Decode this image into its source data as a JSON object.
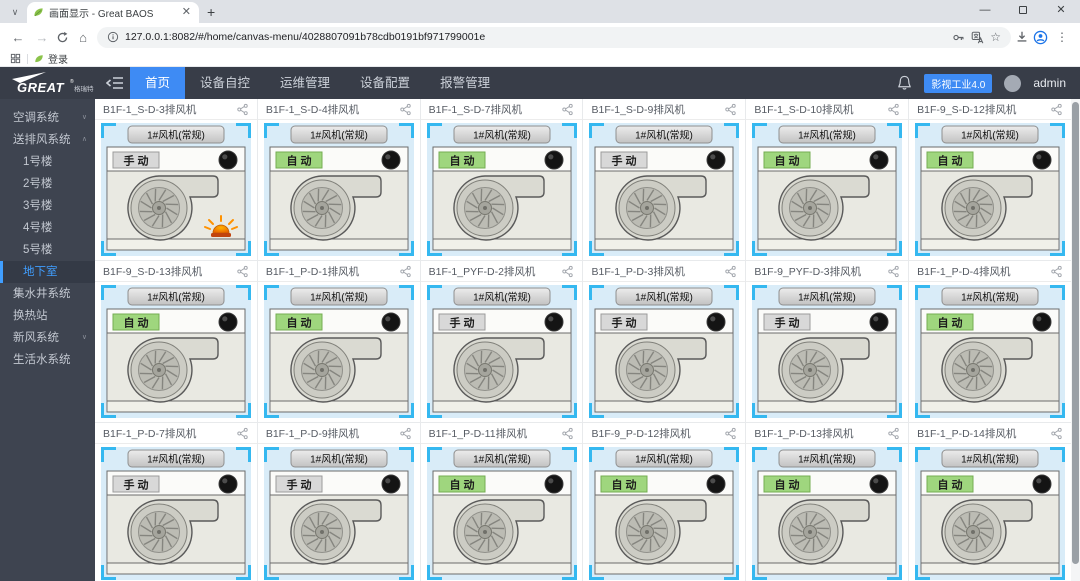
{
  "browser": {
    "tab_title": "画面显示 - Great BAOS",
    "new_tab_button": "+",
    "url": "127.0.0.1:8082/#/home/canvas-menu/4028807091b78cdb0191bf971799001e",
    "bookmarks": [
      {
        "label": "登录"
      }
    ]
  },
  "header": {
    "logo_text": "GREAT",
    "logo_registered": "®",
    "logo_sub": "格瑞特",
    "nav": [
      {
        "label": "首页",
        "active": true
      },
      {
        "label": "设备自控",
        "active": false
      },
      {
        "label": "运维管理",
        "active": false
      },
      {
        "label": "设备配置",
        "active": false
      },
      {
        "label": "报警管理",
        "active": false
      }
    ],
    "badge_label": "影视工业4.0",
    "username": "admin"
  },
  "sidebar": {
    "items": [
      {
        "label": "空调系统",
        "type": "group",
        "chevron": "down",
        "active": false
      },
      {
        "label": "送排风系统",
        "type": "group",
        "chevron": "up",
        "active": false
      },
      {
        "label": "1号楼",
        "type": "child",
        "chevron": "",
        "active": false
      },
      {
        "label": "2号楼",
        "type": "child",
        "chevron": "",
        "active": false
      },
      {
        "label": "3号楼",
        "type": "child",
        "chevron": "",
        "active": false
      },
      {
        "label": "4号楼",
        "type": "child",
        "chevron": "",
        "active": false
      },
      {
        "label": "5号楼",
        "type": "child",
        "chevron": "",
        "active": false
      },
      {
        "label": "地下室",
        "type": "child",
        "chevron": "",
        "active": true
      },
      {
        "label": "集水井系统",
        "type": "group",
        "chevron": "",
        "active": false
      },
      {
        "label": "换热站",
        "type": "group",
        "chevron": "",
        "active": false
      },
      {
        "label": "新风系统",
        "type": "group",
        "chevron": "down",
        "active": false
      },
      {
        "label": "生活水系统",
        "type": "group",
        "chevron": "",
        "active": false
      }
    ]
  },
  "main": {
    "cards": [
      {
        "title": "B1F-1_S-D-3排风机",
        "fan_label": "1#风机(常规)",
        "mode": "manual",
        "mode_label": "手 动",
        "alarm": true
      },
      {
        "title": "B1F-1_S-D-4排风机",
        "fan_label": "1#风机(常规)",
        "mode": "auto",
        "mode_label": "自 动",
        "alarm": false
      },
      {
        "title": "B1F-1_S-D-7排风机",
        "fan_label": "1#风机(常规)",
        "mode": "auto",
        "mode_label": "自 动",
        "alarm": false
      },
      {
        "title": "B1F-1_S-D-9排风机",
        "fan_label": "1#风机(常规)",
        "mode": "manual",
        "mode_label": "手 动",
        "alarm": false
      },
      {
        "title": "B1F-1_S-D-10排风机",
        "fan_label": "1#风机(常规)",
        "mode": "auto",
        "mode_label": "自 动",
        "alarm": false
      },
      {
        "title": "B1F-9_S-D-12排风机",
        "fan_label": "1#风机(常规)",
        "mode": "auto",
        "mode_label": "自 动",
        "alarm": false
      },
      {
        "title": "B1F-9_S-D-13排风机",
        "fan_label": "1#风机(常规)",
        "mode": "auto",
        "mode_label": "自 动",
        "alarm": false
      },
      {
        "title": "B1F-1_P-D-1排风机",
        "fan_label": "1#风机(常规)",
        "mode": "auto",
        "mode_label": "自 动",
        "alarm": false
      },
      {
        "title": "B1F-1_PYF-D-2排风机",
        "fan_label": "1#风机(常规)",
        "mode": "manual",
        "mode_label": "手 动",
        "alarm": false
      },
      {
        "title": "B1F-1_P-D-3排风机",
        "fan_label": "1#风机(常规)",
        "mode": "manual",
        "mode_label": "手 动",
        "alarm": false
      },
      {
        "title": "B1F-9_PYF-D-3排风机",
        "fan_label": "1#风机(常规)",
        "mode": "manual",
        "mode_label": "手 动",
        "alarm": false
      },
      {
        "title": "B1F-1_P-D-4排风机",
        "fan_label": "1#风机(常规)",
        "mode": "auto",
        "mode_label": "自 动",
        "alarm": false
      },
      {
        "title": "B1F-1_P-D-7排风机",
        "fan_label": "1#风机(常规)",
        "mode": "manual",
        "mode_label": "手 动",
        "alarm": false
      },
      {
        "title": "B1F-1_P-D-9排风机",
        "fan_label": "1#风机(常规)",
        "mode": "manual",
        "mode_label": "手 动",
        "alarm": false
      },
      {
        "title": "B1F-1_P-D-11排风机",
        "fan_label": "1#风机(常规)",
        "mode": "auto",
        "mode_label": "自 动",
        "alarm": false
      },
      {
        "title": "B1F-9_P-D-12排风机",
        "fan_label": "1#风机(常规)",
        "mode": "auto",
        "mode_label": "自 动",
        "alarm": false
      },
      {
        "title": "B1F-1_P-D-13排风机",
        "fan_label": "1#风机(常规)",
        "mode": "auto",
        "mode_label": "自 动",
        "alarm": false
      },
      {
        "title": "B1F-1_P-D-14排风机",
        "fan_label": "1#风机(常规)",
        "mode": "auto",
        "mode_label": "自 动",
        "alarm": false
      }
    ]
  },
  "icons": {
    "chevron_up": "∧",
    "chevron_down": "∨"
  },
  "colors": {
    "accent_blue": "#3e8bf4",
    "sidebar_active_blue": "#409eff",
    "auto_green": "#9fd67e",
    "auto_green_border": "#74ad52",
    "manual_gray": "#d8d8d8",
    "manual_gray_border": "#9b9b9b",
    "bracket_cyan": "#35b8f0",
    "alarm_orange": "#ff9100"
  }
}
